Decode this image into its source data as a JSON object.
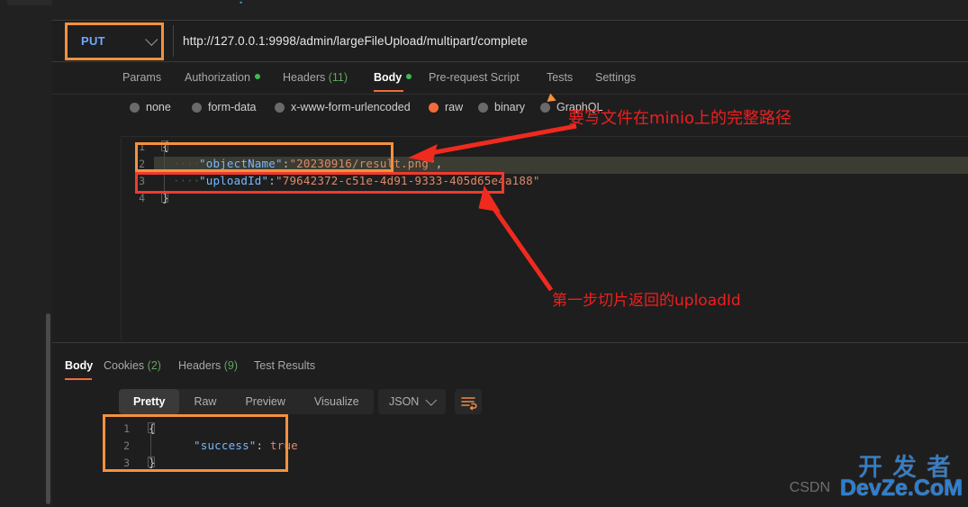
{
  "app": {
    "name": "postman"
  },
  "request": {
    "method": "PUT",
    "url": "http://127.0.0.1:9998/admin/largeFileUpload/multipart/complete",
    "tabs": [
      {
        "label": "Params",
        "badge": "",
        "dot": false,
        "active": false
      },
      {
        "label": "Authorization",
        "badge": "",
        "dot": true,
        "active": false
      },
      {
        "label": "Headers",
        "badge": "(11)",
        "dot": false,
        "active": false
      },
      {
        "label": "Body",
        "badge": "",
        "dot": true,
        "active": true
      },
      {
        "label": "Pre-request Script",
        "badge": "",
        "dot": false,
        "active": false
      },
      {
        "label": "Tests",
        "badge": "",
        "dot": false,
        "active": false
      },
      {
        "label": "Settings",
        "badge": "",
        "dot": false,
        "active": false
      }
    ],
    "body_types": [
      {
        "label": "none",
        "selected": false
      },
      {
        "label": "form-data",
        "selected": false
      },
      {
        "label": "x-www-form-urlencoded",
        "selected": false
      },
      {
        "label": "raw",
        "selected": true
      },
      {
        "label": "binary",
        "selected": false
      },
      {
        "label": "GraphQL",
        "selected": false
      }
    ],
    "body_format": "JSON",
    "body_lines": [
      {
        "no": "1",
        "text": "{"
      },
      {
        "no": "2",
        "key": "\"objectName\"",
        "colon": ":",
        "value": "\"20230916/result.png\"",
        "comma": ","
      },
      {
        "no": "3",
        "key": "\"uploadId\"",
        "colon": ":",
        "value": "\"79642372-c51e-4d91-9333-405d65e4a188\"",
        "comma": ""
      },
      {
        "no": "4",
        "text": "}"
      }
    ]
  },
  "response": {
    "tabs": [
      {
        "label": "Body",
        "badge": "",
        "active": true
      },
      {
        "label": "Cookies",
        "badge": "(2)",
        "active": false
      },
      {
        "label": "Headers",
        "badge": "(9)",
        "active": false
      },
      {
        "label": "Test Results",
        "badge": "",
        "active": false
      }
    ],
    "views": [
      {
        "label": "Pretty",
        "active": true
      },
      {
        "label": "Raw",
        "active": false
      },
      {
        "label": "Preview",
        "active": false
      },
      {
        "label": "Visualize",
        "active": false
      }
    ],
    "format": "JSON",
    "wrap_icon": "word-wrap-icon",
    "body_lines": [
      {
        "no": "1",
        "text": "{"
      },
      {
        "no": "2",
        "key": "\"success\"",
        "colon": ":",
        "value": "true"
      },
      {
        "no": "3",
        "text": "}"
      }
    ]
  },
  "annotations": {
    "note_path": "要写文件在minio上的完整路径",
    "note_upload_id": "第一步切片返回的uploadId",
    "colors": {
      "orange": "#f5913e",
      "red": "#ef3b2d",
      "accent": "#f26b3a"
    }
  },
  "watermark": {
    "cn": "开发者",
    "en": "DevZe.CoM",
    "ghost": "CSDN"
  }
}
